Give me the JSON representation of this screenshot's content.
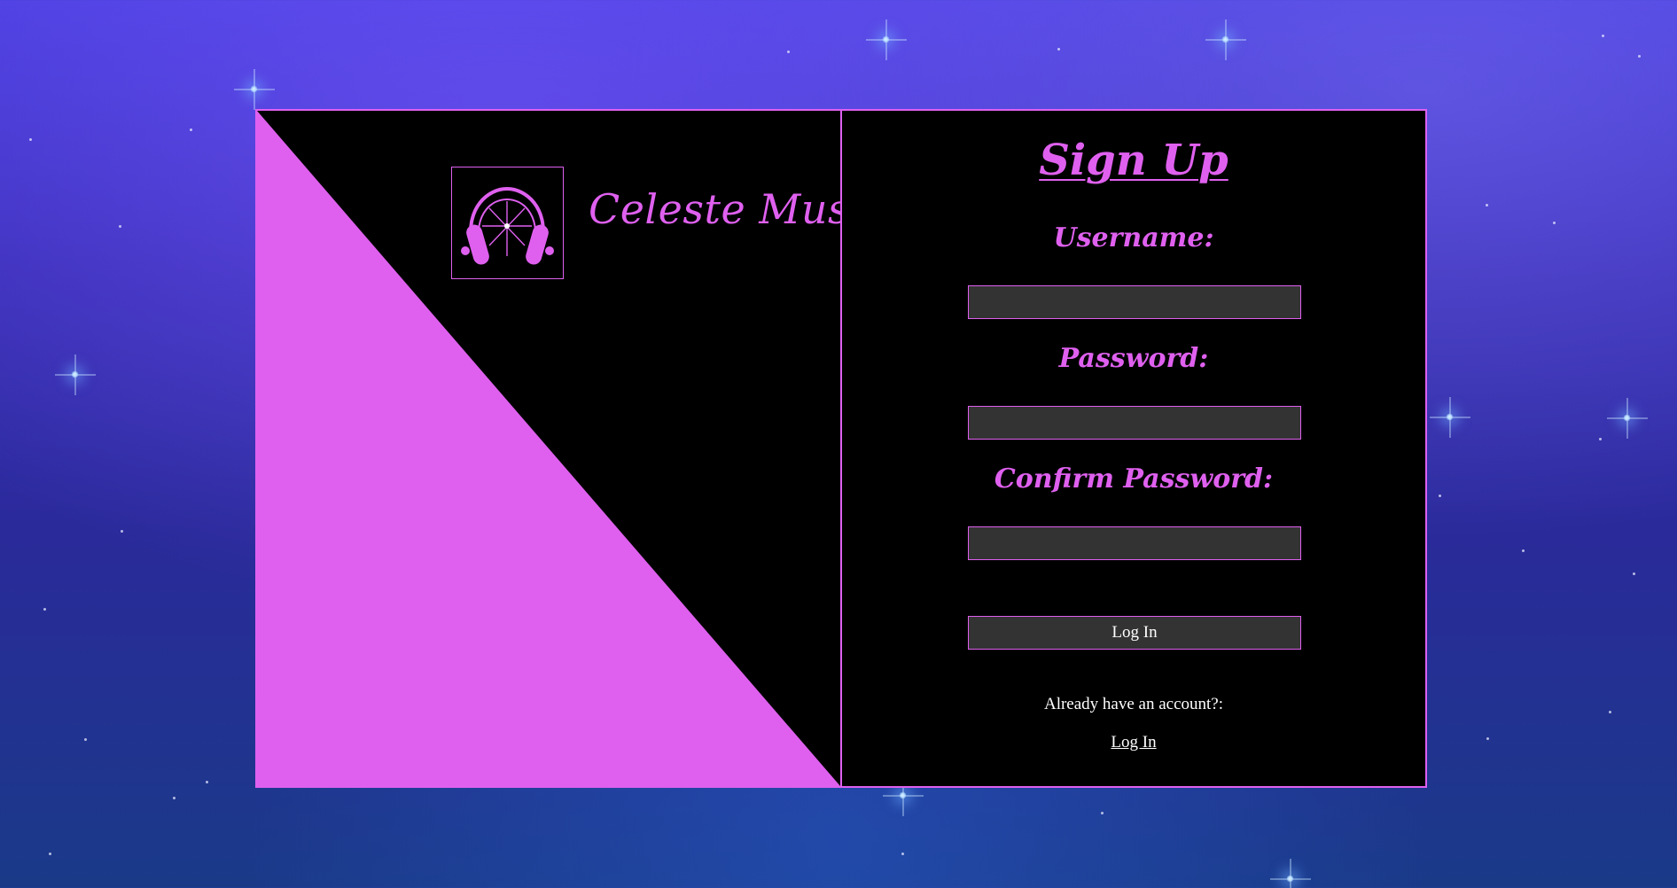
{
  "colors": {
    "accent": "#df60ef",
    "panel_bg": "#000000",
    "input_bg": "#333333",
    "text": "#ffffff"
  },
  "brand": {
    "logo_icon": "headphones-icon",
    "name": "Celeste Music"
  },
  "signup": {
    "title": "Sign Up",
    "username_label": "Username:",
    "username_value": "",
    "password_label": "Password:",
    "password_value": "",
    "confirm_label": "Confirm Password:",
    "confirm_value": "",
    "submit_label": "Log In",
    "already_text": "Already have an account?:",
    "login_link": "Log In"
  }
}
